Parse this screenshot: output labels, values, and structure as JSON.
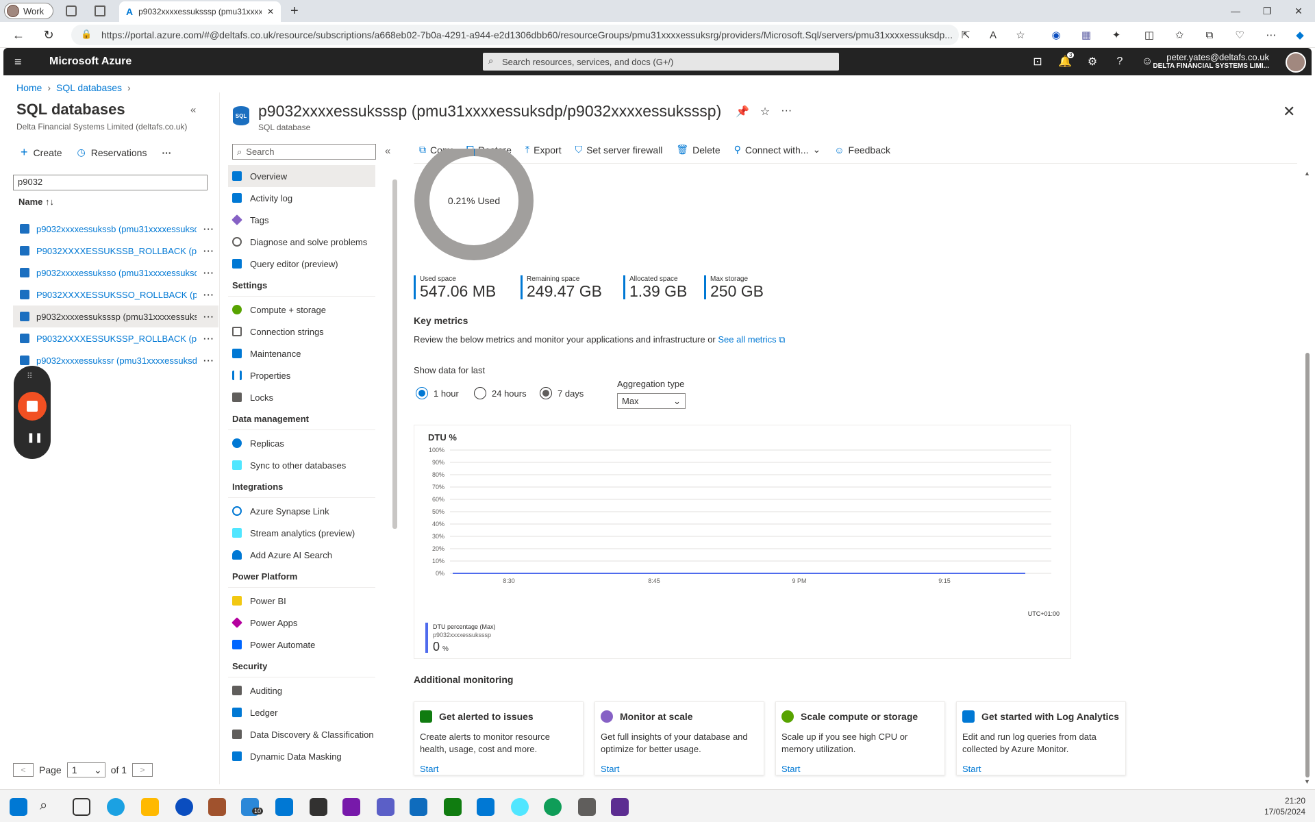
{
  "browser": {
    "profile": "Work",
    "tab_title": "p9032xxxxessuksssp (pmu31xxxxe",
    "url": "https://portal.azure.com/#@deltafs.co.uk/resource/subscriptions/a668eb02-7b0a-4291-a944-e2d1306dbb60/resourceGroups/pmu31xxxxessuksrg/providers/Microsoft.Sql/servers/pmu31xxxxessuksdp..."
  },
  "header": {
    "brand": "Microsoft Azure",
    "search_placeholder": "Search resources, services, and docs (G+/)",
    "notif_count": "3",
    "user_email": "peter.yates@deltafs.co.uk",
    "user_org": "DELTA FINANCIAL SYSTEMS LIMI..."
  },
  "breadcrumb": {
    "home": "Home",
    "sql": "SQL databases"
  },
  "left_pane": {
    "title": "SQL databases",
    "subtitle": "Delta Financial Systems Limited (deltafs.co.uk)",
    "create": "Create",
    "reservations": "Reservations",
    "filter_value": "p9032",
    "name_header": "Name ↑↓",
    "items": [
      {
        "name": "p9032xxxxessukssb (pmu31xxxxessuksd..."
      },
      {
        "name": "P9032XXXXESSUKSSB_ROLLBACK (pmu..."
      },
      {
        "name": "p9032xxxxessukssо (pmu31xxxxessuksd..."
      },
      {
        "name": "P9032XXXXESSUKSSO_ROLLBACK (pmu..."
      },
      {
        "name": "p9032xxxxessuksssp (pmu31xxxxessuksd..."
      },
      {
        "name": "P9032XXXXESSUKSSP_ROLLBACK (pmu..."
      },
      {
        "name": "p9032xxxxessukssr (pmu31xxxxessuksd..."
      }
    ],
    "page_label": "Page",
    "page_value": "1",
    "page_of": "of 1"
  },
  "resource": {
    "title": "p9032xxxxessuksssp (pmu31xxxxessuksdp/p9032xxxxessuksssp)",
    "subtitle": "SQL database",
    "icon_text": "SQL"
  },
  "menu": {
    "search": "Search",
    "groups": [
      {
        "items": [
          "Overview",
          "Activity log",
          "Tags",
          "Diagnose and solve problems",
          "Query editor (preview)"
        ]
      },
      {
        "header": "Settings",
        "items": [
          "Compute + storage",
          "Connection strings",
          "Maintenance",
          "Properties",
          "Locks"
        ]
      },
      {
        "header": "Data management",
        "items": [
          "Replicas",
          "Sync to other databases"
        ]
      },
      {
        "header": "Integrations",
        "items": [
          "Azure Synapse Link",
          "Stream analytics (preview)",
          "Add Azure AI Search"
        ]
      },
      {
        "header": "Power Platform",
        "items": [
          "Power BI",
          "Power Apps",
          "Power Automate"
        ]
      },
      {
        "header": "Security",
        "items": [
          "Auditing",
          "Ledger",
          "Data Discovery & Classification",
          "Dynamic Data Masking"
        ]
      }
    ]
  },
  "toolbar": {
    "copy": "Copy",
    "restore": "Restore",
    "export": "Export",
    "firewall": "Set server firewall",
    "delete": "Delete",
    "connect": "Connect with...",
    "feedback": "Feedback"
  },
  "storage": {
    "used_pct": 0.21,
    "used_label": "0.21% Used",
    "stats": [
      {
        "label": "Used space",
        "value": "547.06 MB"
      },
      {
        "label": "Remaining space",
        "value": "249.47 GB"
      },
      {
        "label": "Allocated space",
        "value": "1.39 GB"
      },
      {
        "label": "Max storage",
        "value": "250 GB"
      }
    ]
  },
  "metrics": {
    "title": "Key metrics",
    "desc": "Review the below metrics and monitor your applications and infrastructure or",
    "link": "See all metrics",
    "show_label": "Show data for last",
    "ranges": [
      "1 hour",
      "24 hours",
      "7 days"
    ],
    "agg_label": "Aggregation type",
    "agg_value": "Max"
  },
  "chart_data": {
    "type": "line",
    "title": "DTU %",
    "yticks": [
      "100%",
      "90%",
      "80%",
      "70%",
      "60%",
      "50%",
      "40%",
      "30%",
      "20%",
      "10%",
      "0%"
    ],
    "ylim": [
      0,
      100
    ],
    "xticks": [
      "8:30",
      "8:45",
      "9 PM",
      "9:15"
    ],
    "timezone": "UTC+01:00",
    "series": [
      {
        "name": "DTU percentage (Max)",
        "sub": "p9032xxxxessuksssp",
        "values": [
          0,
          0,
          0,
          0,
          0,
          0,
          0,
          0,
          0,
          0,
          0,
          0,
          0,
          0,
          0,
          0,
          0,
          0,
          0,
          0
        ]
      }
    ],
    "legend_value": "0",
    "legend_unit": "%",
    "color": "#4f6bed"
  },
  "monitoring": {
    "title": "Additional monitoring",
    "cards": [
      {
        "title": "Get alerted to issues",
        "desc": "Create alerts to monitor resource health, usage, cost and more.",
        "start": "Start",
        "color": "#107c10"
      },
      {
        "title": "Monitor at scale",
        "desc": "Get full insights of your database and optimize for better usage.",
        "start": "Start",
        "color": "#8661c5"
      },
      {
        "title": "Scale compute or storage",
        "desc": "Scale up if you see high CPU or memory utilization.",
        "start": "Start",
        "color": "#57a300"
      },
      {
        "title": "Get started with Log Analytics",
        "desc": "Edit and run log queries from data collected by Azure Monitor.",
        "start": "Start",
        "color": "#0078d4"
      }
    ]
  },
  "taskbar": {
    "time": "21:20",
    "date": "17/05/2024",
    "badge": "10"
  }
}
